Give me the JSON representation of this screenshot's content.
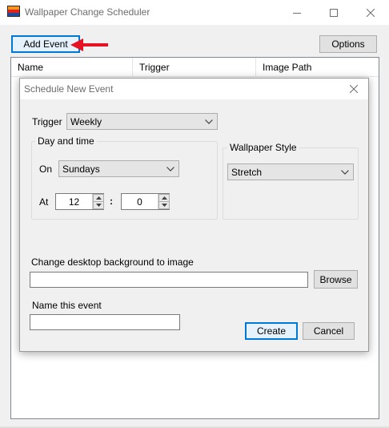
{
  "window": {
    "title": "Wallpaper Change Scheduler",
    "add_event_label": "Add Event",
    "options_label": "Options"
  },
  "list": {
    "columns": [
      "Name",
      "Trigger",
      "Image Path"
    ],
    "rows": []
  },
  "dialog": {
    "title": "Schedule New Event",
    "trigger_label": "Trigger",
    "trigger_value": "Weekly",
    "day_time_group": "Day and time",
    "on_label": "On",
    "on_value": "Sundays",
    "at_label": "At",
    "hour_value": "12",
    "colon": ":",
    "minute_value": "0",
    "style_group": "Wallpaper Style",
    "style_value": "Stretch",
    "image_label": "Change desktop background to image",
    "image_value": "",
    "browse_label": "Browse",
    "name_label": "Name this event",
    "name_value": "",
    "create_label": "Create",
    "cancel_label": "Cancel"
  },
  "colors": {
    "accent": "#0078d7",
    "annotation_arrow": "#e81123"
  }
}
